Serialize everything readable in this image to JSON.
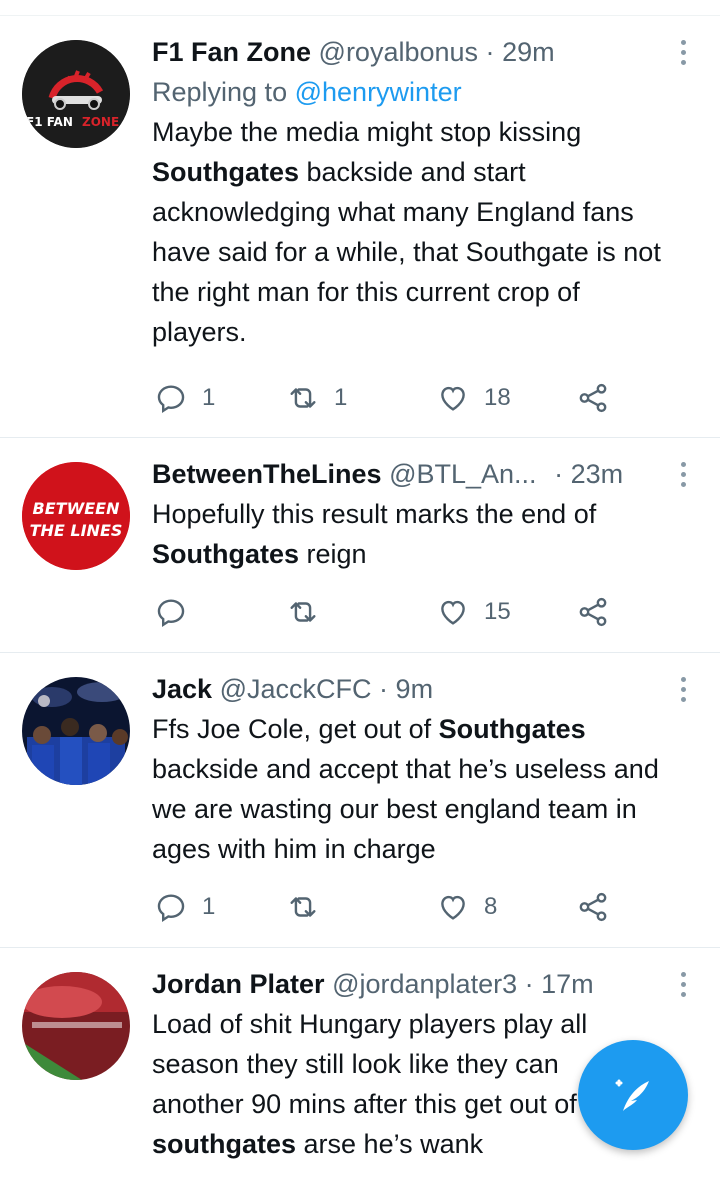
{
  "tweets": [
    {
      "name": "F1 Fan Zone",
      "handle": "@royalbonus",
      "sep": "·",
      "time": "29m",
      "replying_prefix": "Replying to",
      "replying_to": "@henrywinter",
      "text_parts": [
        "Maybe the media might stop kissing ",
        "Southgates",
        " backside and start acknowledging what many England fans have said for a while, that Southgate is not the right man for this current crop of players."
      ],
      "avatar_text": [
        "F1 FAN",
        "ZONE"
      ],
      "replies": "1",
      "retweets": "1",
      "likes": "18"
    },
    {
      "name": "BetweenTheLines",
      "handle": "@BTL_An...",
      "sep": "·",
      "time": "23m",
      "text_parts": [
        "Hopefully this result marks the end of ",
        "Southgates",
        " reign"
      ],
      "avatar_text": [
        "BETWEEN",
        "THE LINES"
      ],
      "replies": "",
      "retweets": "",
      "likes": "15"
    },
    {
      "name": "Jack",
      "handle": "@JacckCFC",
      "sep": "·",
      "time": "9m",
      "text_parts": [
        "Ffs Joe Cole, get out of ",
        "Southgates",
        " backside and accept that he’s useless and we are wasting our best england team in ages with him in charge"
      ],
      "replies": "1",
      "retweets": "",
      "likes": "8"
    },
    {
      "name": "Jordan Plater",
      "handle": "@jordanplater3",
      "sep": "·",
      "time": "17m",
      "text_parts": [
        "Load of shit Hungary players play all season they still look like they ca",
        "",
        "n another 90 mins after this get ou",
        "t of ",
        "southgates",
        " arse he’s wank"
      ],
      "replies": "",
      "retweets": "",
      "likes": ""
    }
  ],
  "colors": {
    "accent": "#1d9bf0",
    "muted": "#536471",
    "text": "#0f1419",
    "divider": "#e6ecf0"
  },
  "icons": {
    "reply": "reply-icon",
    "retweet": "retweet-icon",
    "like": "heart-icon",
    "share": "share-icon",
    "more": "more-vertical-icon",
    "compose": "compose-tweet-icon"
  }
}
